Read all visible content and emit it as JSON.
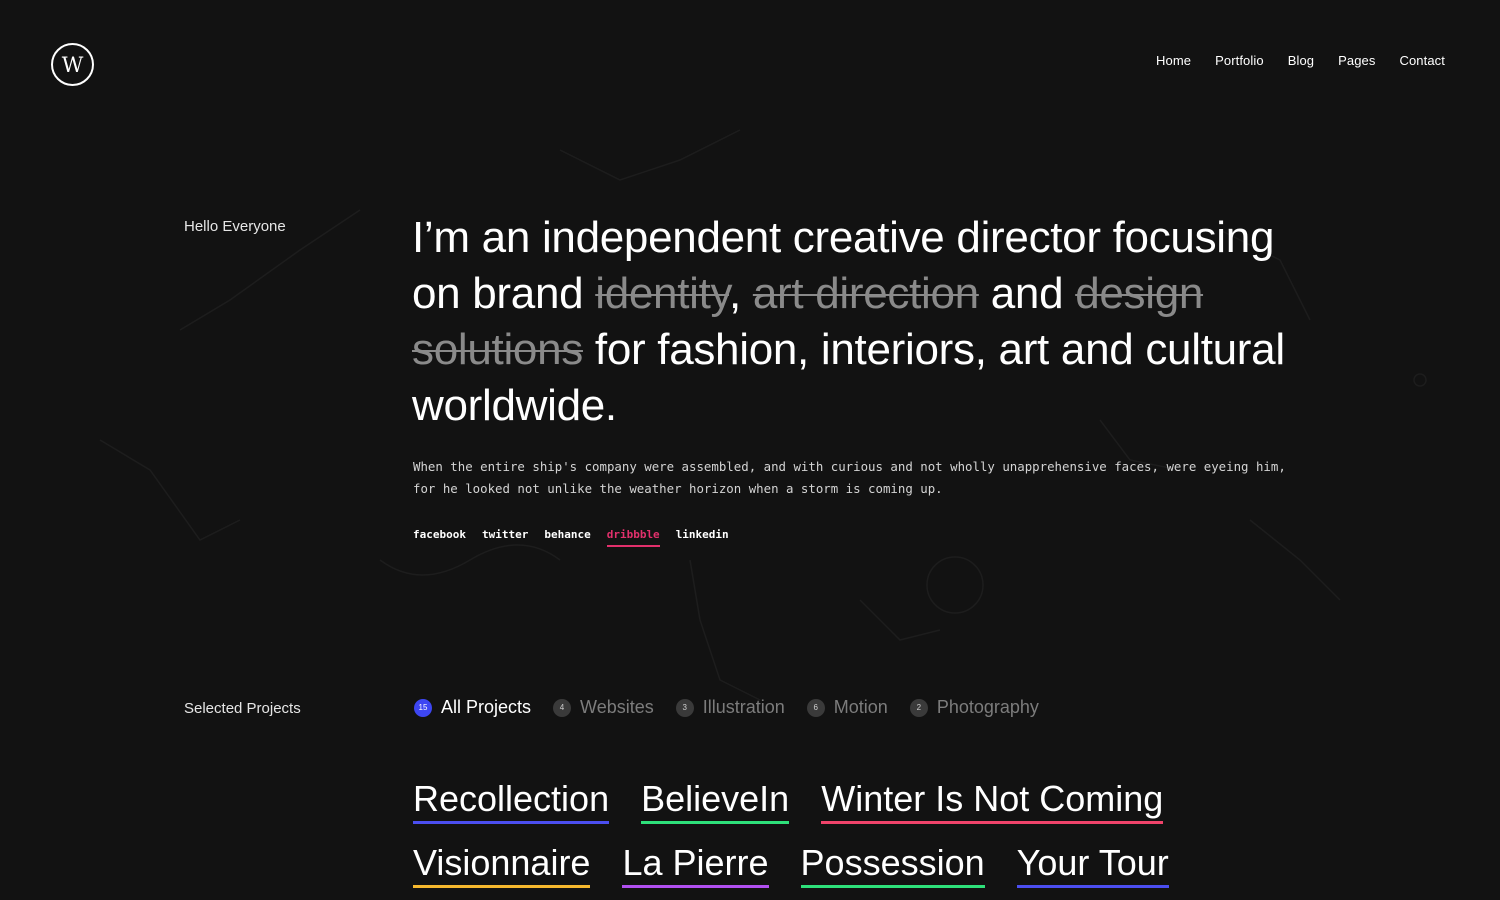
{
  "header": {
    "logo_letter": "W",
    "nav": [
      "Home",
      "Portfolio",
      "Blog",
      "Pages",
      "Contact"
    ]
  },
  "hero": {
    "label": "Hello Everyone",
    "title_parts": {
      "p1": "I’m an independent creative director focusing on brand ",
      "s1": "identity",
      "p2": ", ",
      "s2": "art direction",
      "p3": " and ",
      "s3": "design solutions",
      "p4": " for fashion, interiors, art and cultural worldwide."
    },
    "description": "When the entire ship's company were assembled, and with curious and not wholly unapprehensive faces, were eyeing him, for he looked not unlike the weather horizon when a storm is coming up.",
    "social": [
      {
        "label": "facebook",
        "active": false
      },
      {
        "label": "twitter",
        "active": false
      },
      {
        "label": "behance",
        "active": false
      },
      {
        "label": "dribbble",
        "active": true
      },
      {
        "label": "linkedin",
        "active": false
      }
    ]
  },
  "projects_section": {
    "label": "Selected Projects",
    "filters": [
      {
        "label": "All Projects",
        "count": "15",
        "active": true
      },
      {
        "label": "Websites",
        "count": "4",
        "active": false
      },
      {
        "label": "Illustration",
        "count": "3",
        "active": false
      },
      {
        "label": "Motion",
        "count": "6",
        "active": false
      },
      {
        "label": "Photography",
        "count": "2",
        "active": false
      }
    ],
    "projects_row1": [
      {
        "title": "Recollection",
        "underline": "#4b4ef0"
      },
      {
        "title": "BelieveIn",
        "underline": "#2ee07a"
      },
      {
        "title": "Winter Is Not Coming",
        "underline": "#f0436a"
      }
    ],
    "projects_row2": [
      {
        "title": "Visionnaire",
        "underline": "#f5b82e"
      },
      {
        "title": "La Pierre",
        "underline": "#b150f0"
      },
      {
        "title": "Possession",
        "underline": "#2ee07a"
      },
      {
        "title": "Your Tour",
        "underline": "#4b4ef0"
      }
    ]
  },
  "colors": {
    "background": "#121212",
    "accent_social": "#e3306c",
    "accent_filter": "#3d46f2"
  }
}
